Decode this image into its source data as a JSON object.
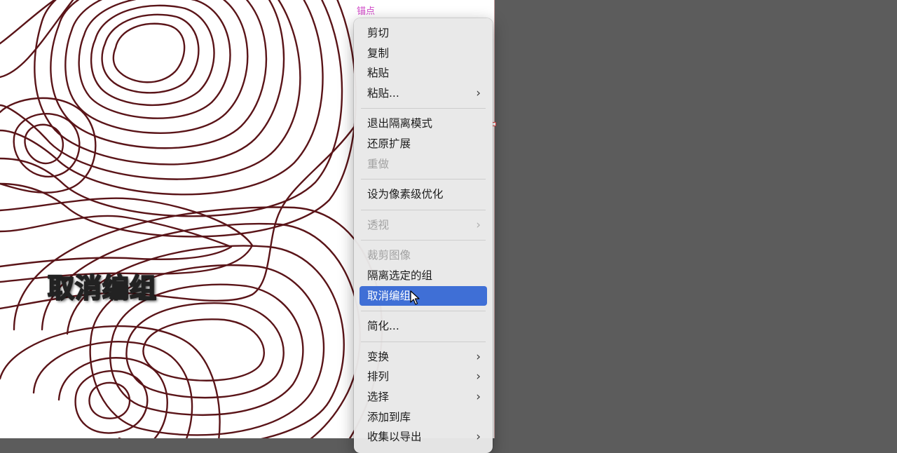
{
  "canvas": {
    "anchor_label": "锚点",
    "caption": "取消编组"
  },
  "context_menu": {
    "groups": [
      [
        {
          "label": "剪切",
          "enabled": true,
          "submenu": false
        },
        {
          "label": "复制",
          "enabled": true,
          "submenu": false
        },
        {
          "label": "粘贴",
          "enabled": true,
          "submenu": false
        },
        {
          "label": "粘贴...",
          "enabled": true,
          "submenu": true
        }
      ],
      [
        {
          "label": "退出隔离模式",
          "enabled": true,
          "submenu": false
        },
        {
          "label": "还原扩展",
          "enabled": true,
          "submenu": false
        },
        {
          "label": "重做",
          "enabled": false,
          "submenu": false
        }
      ],
      [
        {
          "label": "设为像素级优化",
          "enabled": true,
          "submenu": false
        }
      ],
      [
        {
          "label": "透视",
          "enabled": false,
          "submenu": true
        }
      ],
      [
        {
          "label": "裁剪图像",
          "enabled": false,
          "submenu": false
        },
        {
          "label": "隔离选定的组",
          "enabled": true,
          "submenu": false
        },
        {
          "label": "取消编组",
          "enabled": true,
          "submenu": false,
          "highlighted": true
        }
      ],
      [
        {
          "label": "简化...",
          "enabled": true,
          "submenu": false
        }
      ],
      [
        {
          "label": "变换",
          "enabled": true,
          "submenu": true
        },
        {
          "label": "排列",
          "enabled": true,
          "submenu": true
        },
        {
          "label": "选择",
          "enabled": true,
          "submenu": true
        },
        {
          "label": "添加到库",
          "enabled": true,
          "submenu": false
        },
        {
          "label": "收集以导出",
          "enabled": true,
          "submenu": true
        }
      ]
    ],
    "chevron_glyph": "›"
  },
  "colors": {
    "contour_stroke": "#5a1418",
    "highlight": "#3f6fd6",
    "anchor_label": "#d148c8",
    "workspace_bg": "#5c5c5c"
  }
}
